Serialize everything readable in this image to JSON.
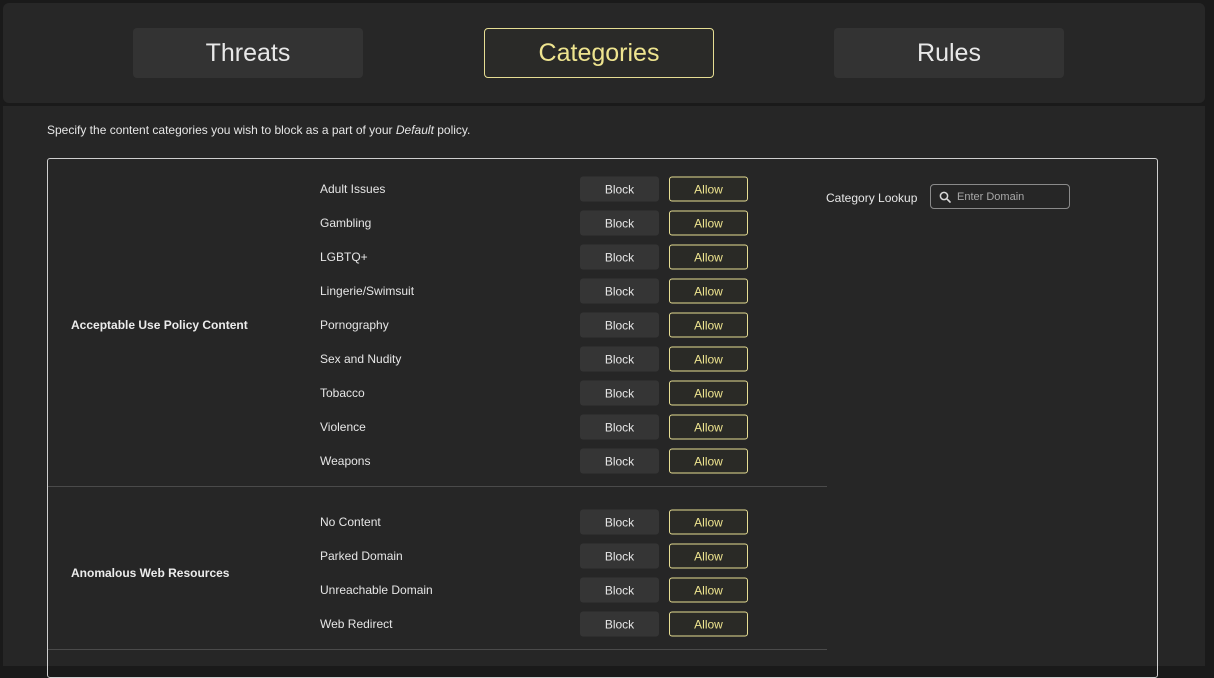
{
  "tabs": [
    {
      "label": "Threats",
      "active": false
    },
    {
      "label": "Categories",
      "active": true
    },
    {
      "label": "Rules",
      "active": false
    }
  ],
  "description": {
    "prefix": "Specify the content categories you wish to block as a part of your",
    "policy": "Default",
    "suffix": "policy."
  },
  "lookup": {
    "label": "Category Lookup",
    "placeholder": "Enter Domain",
    "icon": "search-icon"
  },
  "buttons": {
    "block": "Block",
    "allow": "Allow"
  },
  "colors": {
    "accent": "#eee48f",
    "background": "#262626",
    "header": "#272727"
  },
  "groups": [
    {
      "name": "Acceptable Use Policy Content",
      "categories": [
        "Adult Issues",
        "Gambling",
        "LGBTQ+",
        "Lingerie/Swimsuit",
        "Pornography",
        "Sex and Nudity",
        "Tobacco",
        "Violence",
        "Weapons"
      ],
      "selected": "Allow"
    },
    {
      "name": "Anomalous Web Resources",
      "categories": [
        "No Content",
        "Parked Domain",
        "Unreachable Domain",
        "Web Redirect"
      ],
      "selected": "Allow"
    }
  ]
}
